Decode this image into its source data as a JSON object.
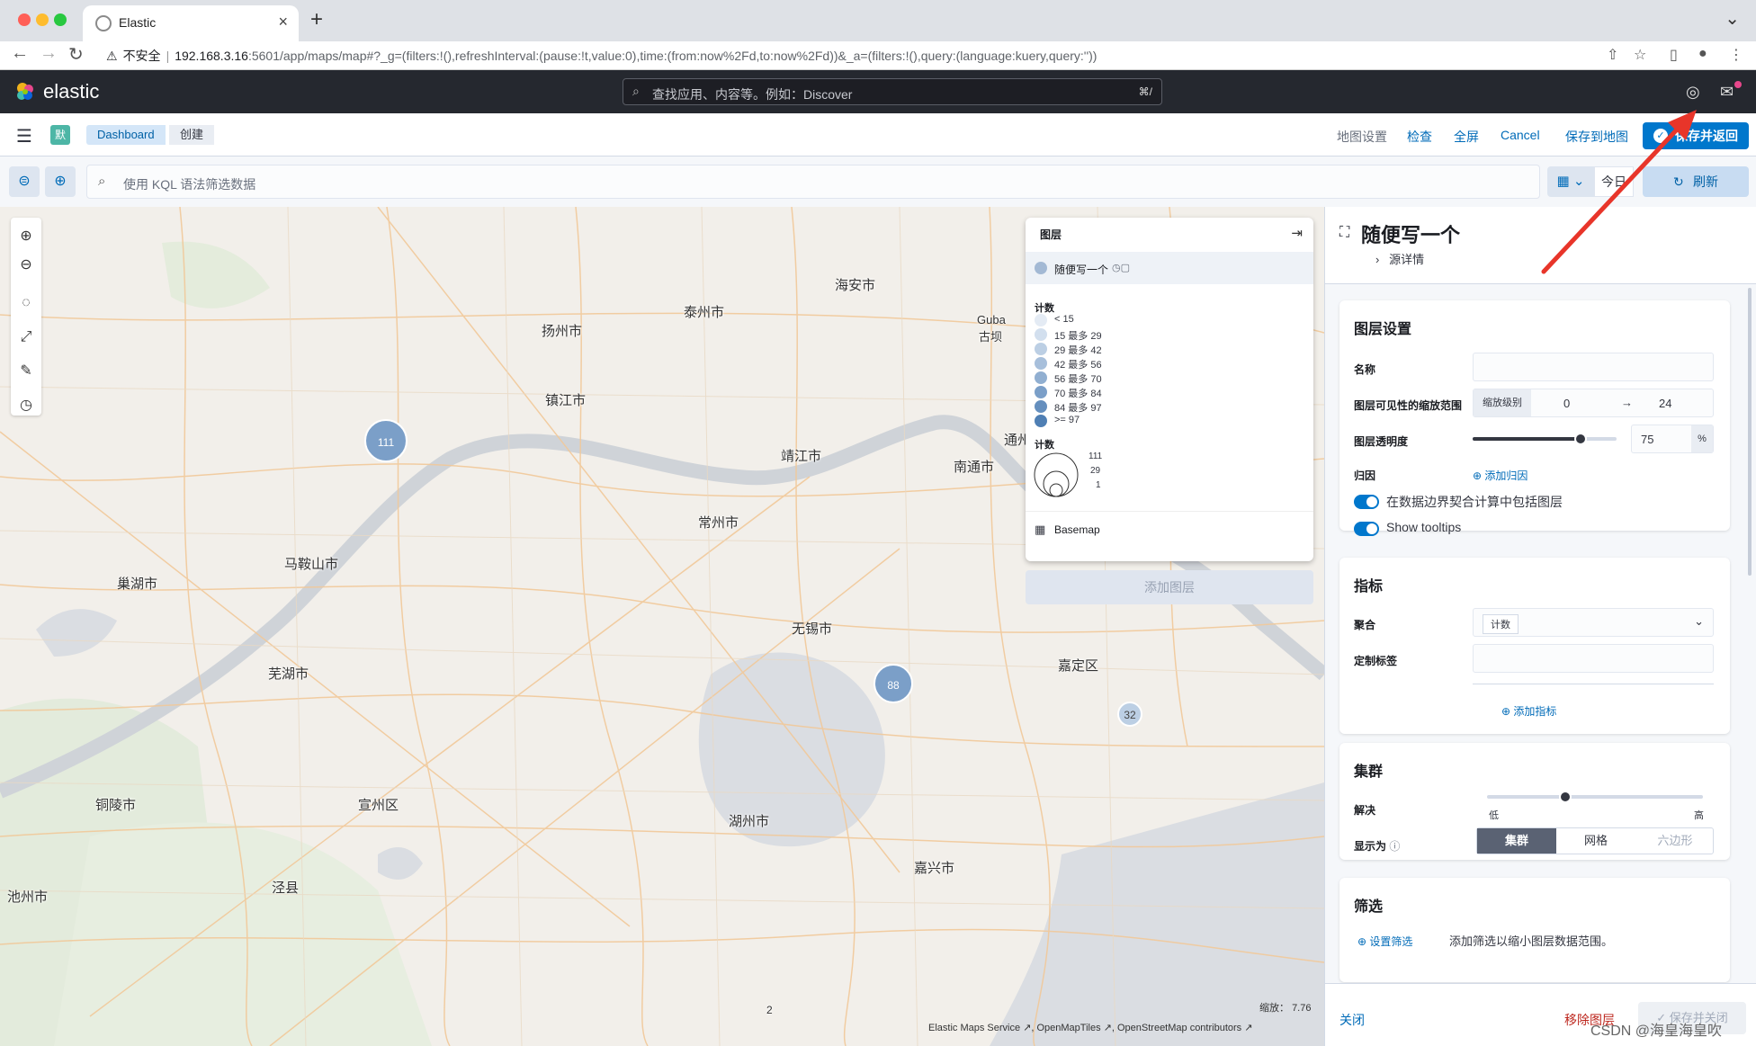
{
  "browser": {
    "tab_title": "Elastic",
    "security_label": "不安全",
    "url_host": "192.168.3.16",
    "url_path": ":5601/app/maps/map#?_g=(filters:!(),refreshInterval:(pause:!t,value:0),time:(from:now%2Fd,to:now%2Fd))&_a=(filters:!(),query:(language:kuery,query:''))"
  },
  "header": {
    "brand": "elastic",
    "search_placeholder": "查找应用、内容等。例如：Discover",
    "search_shortcut": "⌘/"
  },
  "breadcrumb": {
    "space_badge": "默",
    "items": [
      "Dashboard",
      "创建"
    ]
  },
  "toolbar": {
    "map_settings": "地图设置",
    "inspect": "检查",
    "fullscreen": "全屏",
    "cancel": "Cancel",
    "save_to_map": "保存到地图",
    "save_return": "保存并返回"
  },
  "query": {
    "placeholder": "使用 KQL 语法筛选数据",
    "date": "今日",
    "refresh": "刷新"
  },
  "map": {
    "cities": [
      {
        "name": "海安市"
      },
      {
        "name": "泰州市"
      },
      {
        "name": "扬州市"
      },
      {
        "name": "Guba"
      },
      {
        "name": "古坝"
      },
      {
        "name": "镇江市"
      },
      {
        "name": "靖江市"
      },
      {
        "name": "南通市"
      },
      {
        "name": "通州"
      },
      {
        "name": "常州市"
      },
      {
        "name": "马鞍山市"
      },
      {
        "name": "巢湖市"
      },
      {
        "name": "无锡市"
      },
      {
        "name": "芜湖市"
      },
      {
        "name": "嘉定区"
      },
      {
        "name": "铜陵市"
      },
      {
        "name": "宣州区"
      },
      {
        "name": "湖州市"
      },
      {
        "name": "嘉兴市"
      },
      {
        "name": "泾县"
      },
      {
        "name": "池州市"
      },
      {
        "name": "2"
      }
    ],
    "clusters": [
      {
        "label": "111"
      },
      {
        "label": "88"
      },
      {
        "label": "32"
      }
    ],
    "zoom_label": "缩放：",
    "zoom_value": "7.76",
    "attribution": "Elastic Maps Service ↗, OpenMapTiles ↗, OpenStreetMap contributors ↗"
  },
  "legend": {
    "title": "图层",
    "layer_name": "随便写一个",
    "count_title": "计数",
    "ranges": [
      {
        "label": "< 15",
        "color": "#e4ebf4"
      },
      {
        "label": "15 最多 29",
        "color": "#d2dfee"
      },
      {
        "label": "29 最多 42",
        "color": "#bccfe4"
      },
      {
        "label": "42 最多 56",
        "color": "#a7bfdb"
      },
      {
        "label": "56 最多 70",
        "color": "#91afd1"
      },
      {
        "label": "70 最多 84",
        "color": "#7b9fc8"
      },
      {
        "label": "84 最多 97",
        "color": "#658fbe"
      },
      {
        "label": ">= 97",
        "color": "#4f7fb4"
      }
    ],
    "size_title": "计数",
    "size_values": [
      "111",
      "29",
      "1"
    ],
    "basemap": "Basemap",
    "add_layer": "添加图层"
  },
  "panel": {
    "title": "随便写一个",
    "source_details": "源详情",
    "layer_settings": {
      "title": "图层设置",
      "name_label": "名称",
      "zoom_label": "图层可见性的缩放范围",
      "zoom_prefix": "缩放级别",
      "zoom_min": "0",
      "zoom_max": "24",
      "opacity_label": "图层透明度",
      "opacity_value": "75",
      "opacity_unit": "%",
      "opacity_fraction": 0.75,
      "attribution_label": "归因",
      "add_attribution": "添加归因",
      "toggle1": "在数据边界契合计算中包括图层",
      "toggle2": "Show tooltips"
    },
    "metrics": {
      "title": "指标",
      "agg_label": "聚合",
      "agg_value": "计数",
      "custom_label": "定制标签",
      "add_metric": "添加指标"
    },
    "clusters": {
      "title": "集群",
      "resolution_label": "解决",
      "low": "低",
      "high": "高",
      "display_label": "显示为",
      "options": [
        "集群",
        "网格",
        "六边形"
      ],
      "selected": "集群"
    },
    "filter": {
      "title": "筛选",
      "set_filter": "设置筛选",
      "description": "添加筛选以缩小图层数据范围。"
    },
    "footer": {
      "close": "关闭",
      "remove": "移除图层",
      "save_close": "保存并关闭"
    }
  },
  "watermark": "CSDN @海皇海皇吹"
}
